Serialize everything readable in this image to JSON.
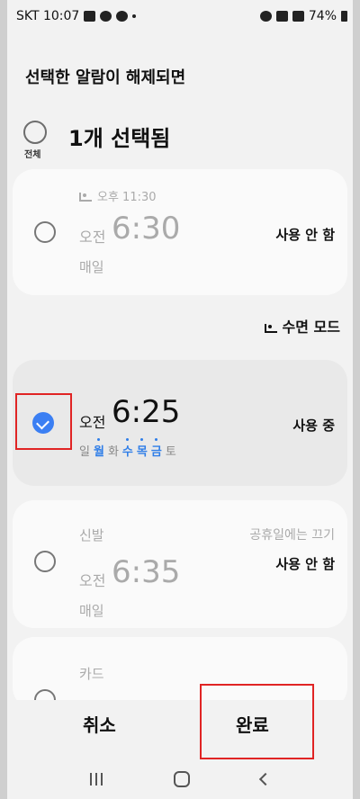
{
  "status_bar": {
    "carrier_time": "SKT 10:07",
    "battery": "74%"
  },
  "header": {
    "title": "선택한 알람이 해제되면",
    "select_all_label": "전체",
    "selected_count": "1개 선택됨"
  },
  "alarms": [
    {
      "meta": "오후 11:30",
      "ampm": "오전",
      "time": "6:30",
      "repeat": "매일",
      "status": "사용 안 함",
      "checked": false
    },
    {
      "ampm": "오전",
      "time": "6:25",
      "days": [
        "일",
        "월",
        "화",
        "수",
        "목",
        "금",
        "토"
      ],
      "days_active": [
        false,
        true,
        false,
        true,
        true,
        true,
        false
      ],
      "status": "사용 중",
      "checked": true
    },
    {
      "name": "신발",
      "holiday_note": "공휴일에는 끄기",
      "ampm": "오전",
      "time": "6:35",
      "repeat": "매일",
      "status": "사용 안 함",
      "checked": false
    },
    {
      "name": "카드",
      "checked": false
    }
  ],
  "sleep_mode_label": "수면 모드",
  "buttons": {
    "cancel": "취소",
    "done": "완료"
  },
  "colors": {
    "accent": "#3b7ff3",
    "highlight": "#e02424"
  }
}
